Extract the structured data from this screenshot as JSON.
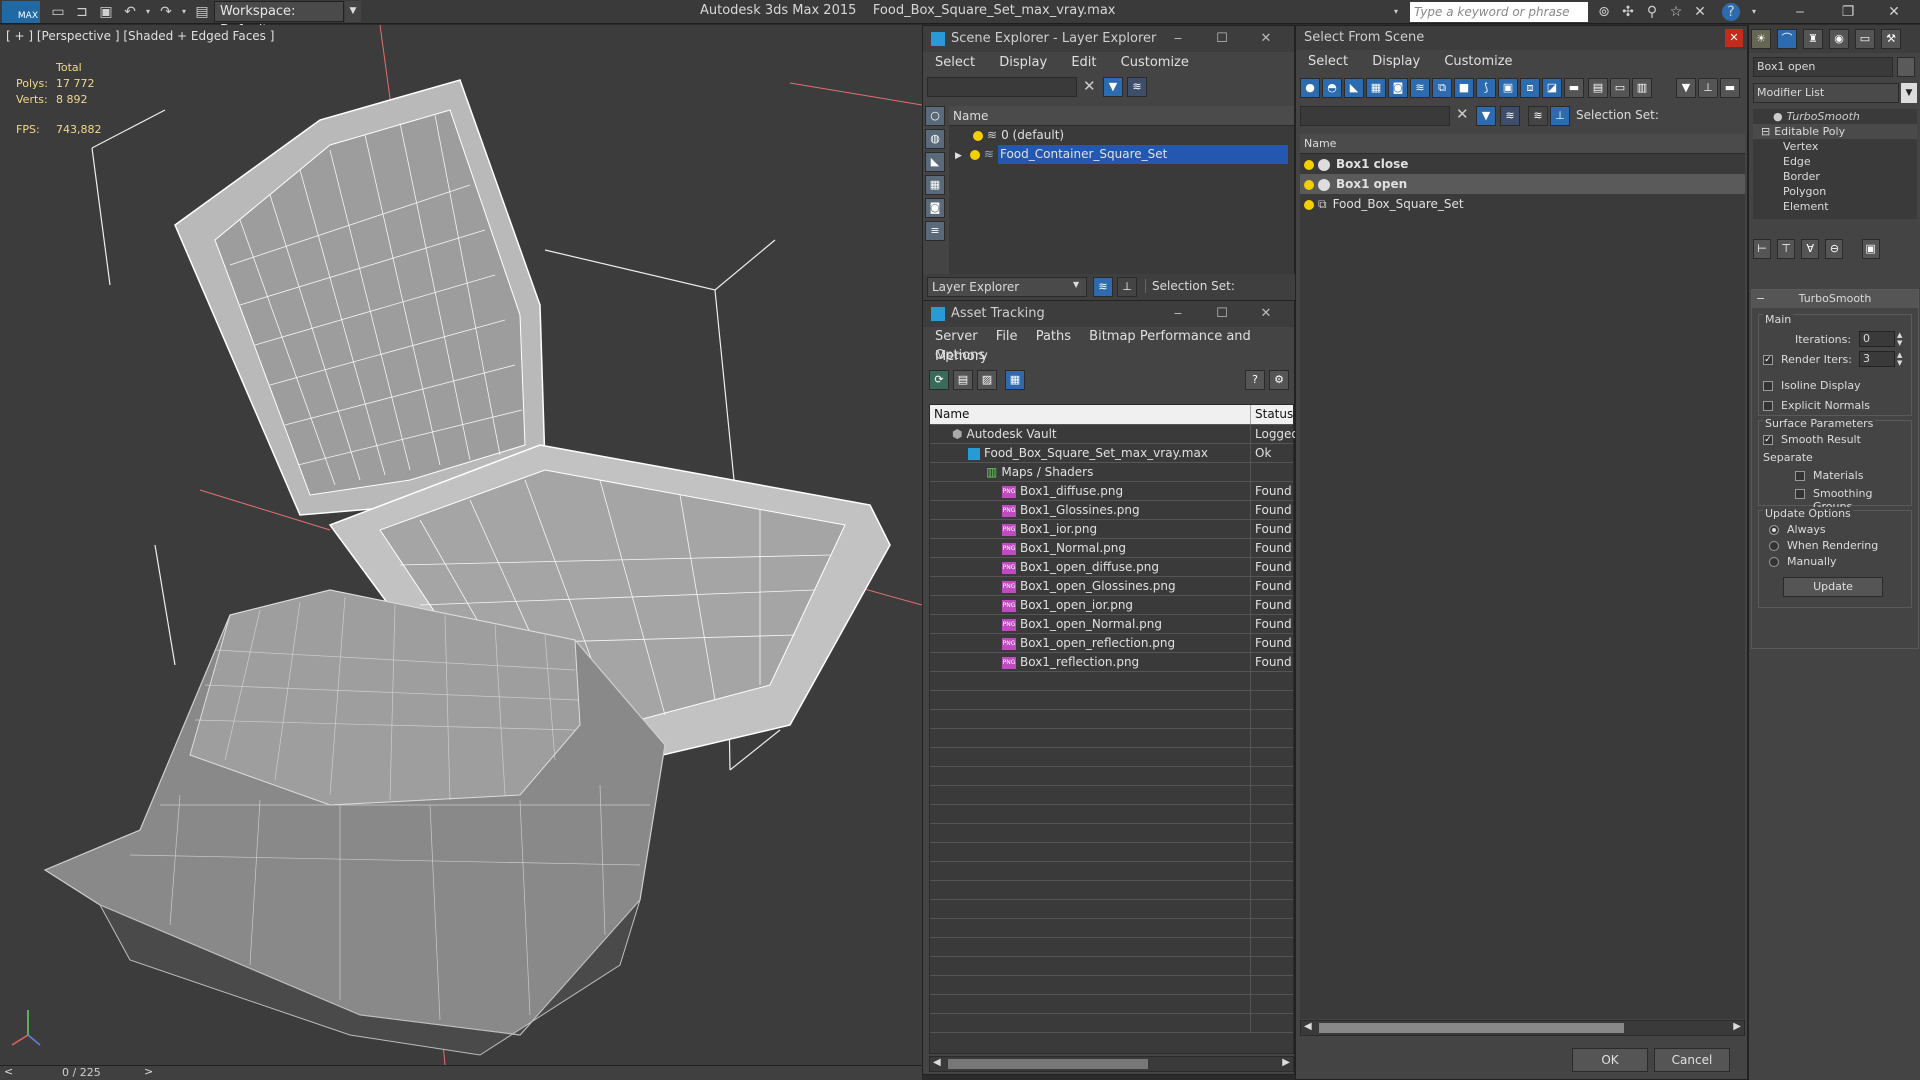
{
  "titlebar": {
    "logo": "MAX",
    "workspace": "Workspace: Default",
    "app_name": "Autodesk 3ds Max  2015",
    "file_name": "Food_Box_Square_Set_max_vray.max",
    "search_placeholder": "Type a keyword or phrase"
  },
  "viewport": {
    "label": "[ + ] [Perspective ] [Shaded + Edged Faces ]",
    "stats_total": "Total",
    "polys_label": "Polys:",
    "polys_value": "17 772",
    "verts_label": "Verts:",
    "verts_value": "8 892",
    "fps_label": "FPS:",
    "fps_value": "743,882",
    "frame_counter": "0 / 225"
  },
  "scene_explorer": {
    "title": "Scene Explorer - Layer Explorer",
    "menu": [
      "Select",
      "Display",
      "Edit",
      "Customize"
    ],
    "column": "Name",
    "rows": [
      "0 (default)",
      "Food_Container_Square_Set"
    ],
    "footer_dropdown": "Layer Explorer",
    "footer_selection": "Selection Set:"
  },
  "asset_tracking": {
    "title": "Asset Tracking",
    "menu": [
      "Server",
      "File",
      "Paths",
      "Bitmap Performance and Memory"
    ],
    "menu_row2": "Options",
    "col_name": "Name",
    "col_status": "Status",
    "vault": {
      "name": "Autodesk Vault",
      "status": "Logged"
    },
    "file": {
      "name": "Food_Box_Square_Set_max_vray.max",
      "status": "Ok"
    },
    "maps_group": "Maps / Shaders",
    "file_icon_text": "PNG",
    "maps": [
      {
        "name": "Box1_diffuse.png",
        "status": "Found"
      },
      {
        "name": "Box1_Glossines.png",
        "status": "Found"
      },
      {
        "name": "Box1_ior.png",
        "status": "Found"
      },
      {
        "name": "Box1_Normal.png",
        "status": "Found"
      },
      {
        "name": "Box1_open_diffuse.png",
        "status": "Found"
      },
      {
        "name": "Box1_open_Glossines.png",
        "status": "Found"
      },
      {
        "name": "Box1_open_ior.png",
        "status": "Found"
      },
      {
        "name": "Box1_open_Normal.png",
        "status": "Found"
      },
      {
        "name": "Box1_open_reflection.png",
        "status": "Found"
      },
      {
        "name": "Box1_reflection.png",
        "status": "Found"
      }
    ]
  },
  "select_from_scene": {
    "title": "Select From Scene",
    "menu": [
      "Select",
      "Display",
      "Customize"
    ],
    "selection_set": "Selection Set:",
    "column": "Name",
    "rows": [
      "Box1 close",
      "Box1 open",
      "Food_Box_Square_Set"
    ],
    "ok": "OK",
    "cancel": "Cancel"
  },
  "command_panel": {
    "object_name": "Box1 open",
    "modifier_list": "Modifier List",
    "stack": [
      "TurboSmooth",
      "Editable Poly",
      "Vertex",
      "Edge",
      "Border",
      "Polygon",
      "Element"
    ],
    "rollout_title": "TurboSmooth",
    "main_label": "Main",
    "iterations_label": "Iterations:",
    "iterations_value": "0",
    "render_iters_label": "Render Iters:",
    "render_iters_value": "3",
    "isoline": "Isoline Display",
    "explicit_normals": "Explicit Normals",
    "surface_params": "Surface Parameters",
    "smooth_result": "Smooth Result",
    "separate": "Separate",
    "materials": "Materials",
    "smoothing_groups": "Smoothing Groups",
    "update_options": "Update Options",
    "always": "Always",
    "when_rendering": "When Rendering",
    "manually": "Manually",
    "update_btn": "Update"
  }
}
